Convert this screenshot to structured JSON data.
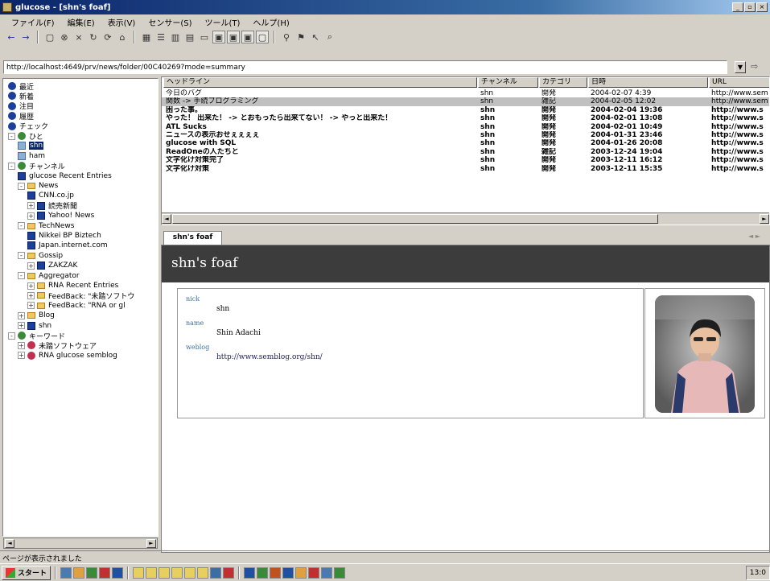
{
  "window": {
    "title": "glucose - [shn's foaf]",
    "minimize_glyph": "_",
    "restore_glyph": "▫",
    "close_glyph": "×"
  },
  "menubar": {
    "items": [
      "ファイル(F)",
      "編集(E)",
      "表示(V)",
      "センサー(S)",
      "ツール(T)",
      "ヘルプ(H)"
    ]
  },
  "toolbar": {
    "buttons": [
      {
        "icon": "back-arrow-icon",
        "glyph": "←"
      },
      {
        "icon": "forward-arrow-icon",
        "glyph": "→"
      },
      {
        "icon": "document-icon",
        "glyph": "▢"
      },
      {
        "icon": "stop-icon",
        "glyph": "⊗"
      },
      {
        "icon": "close-icon",
        "glyph": "×"
      },
      {
        "icon": "refresh-icon",
        "glyph": "↻"
      },
      {
        "icon": "refresh-all-icon",
        "glyph": "⟳"
      },
      {
        "icon": "home-icon",
        "glyph": "⌂"
      },
      {
        "icon": "grid-view-icon",
        "glyph": "▦"
      },
      {
        "icon": "list-view-icon",
        "glyph": "☰"
      },
      {
        "icon": "columns-view-icon",
        "glyph": "▥"
      },
      {
        "icon": "tile-view-icon",
        "glyph": "▤"
      },
      {
        "icon": "horizontal-split-icon",
        "glyph": "▭"
      },
      {
        "icon": "layout-1-icon",
        "glyph": "▣"
      },
      {
        "icon": "layout-2-icon",
        "glyph": "▣"
      },
      {
        "icon": "layout-3-icon",
        "glyph": "▣"
      },
      {
        "icon": "layout-4-icon",
        "glyph": "▢"
      },
      {
        "icon": "wand-icon",
        "glyph": "⚲"
      },
      {
        "icon": "filter-icon",
        "glyph": "⚑"
      },
      {
        "icon": "pointer-icon",
        "glyph": "↖"
      },
      {
        "icon": "search-icon",
        "glyph": "⌕"
      }
    ]
  },
  "address": {
    "url": "http://localhost:4649/prv/news/folder/00C40269?mode=summary",
    "dropdown_glyph": "▼",
    "go_glyph": "⇨"
  },
  "tree": {
    "nodes": [
      {
        "label": "最近",
        "icon": "recent-icon",
        "depth": 0,
        "expander": "",
        "type": "dot",
        "color": "#1c3f9a"
      },
      {
        "label": "新着",
        "icon": "new-items-icon",
        "depth": 0,
        "expander": "",
        "type": "dot",
        "color": "#1c3f9a"
      },
      {
        "label": "注目",
        "icon": "starred-icon",
        "depth": 0,
        "expander": "",
        "type": "dot",
        "color": "#1c3f9a"
      },
      {
        "label": "履歴",
        "icon": "history-icon",
        "depth": 0,
        "expander": "",
        "type": "dot",
        "color": "#1c3f9a"
      },
      {
        "label": "チェック",
        "icon": "check-icon",
        "depth": 0,
        "expander": "",
        "type": "dot",
        "color": "#1c3f9a"
      },
      {
        "label": "ひと",
        "icon": "people-icon",
        "depth": 0,
        "expander": "-",
        "type": "dot",
        "color": "#3a8a3a"
      },
      {
        "label": "shn",
        "icon": "person-icon",
        "depth": 1,
        "expander": "",
        "type": "person",
        "selected": true
      },
      {
        "label": "ham",
        "icon": "person-icon",
        "depth": 1,
        "expander": "",
        "type": "person"
      },
      {
        "label": "チャンネル",
        "icon": "channel-icon",
        "depth": 0,
        "expander": "-",
        "type": "dot",
        "color": "#3a8a3a"
      },
      {
        "label": "glucose Recent Entries",
        "icon": "feed-icon",
        "depth": 1,
        "expander": "",
        "type": "feed"
      },
      {
        "label": "News",
        "icon": "folder-icon",
        "depth": 1,
        "expander": "-",
        "type": "folder"
      },
      {
        "label": "CNN.co.jp",
        "icon": "feed-icon",
        "depth": 2,
        "expander": "",
        "type": "feed"
      },
      {
        "label": "読売新聞",
        "icon": "feed-icon",
        "depth": 2,
        "expander": "+",
        "type": "feed"
      },
      {
        "label": "Yahoo! News",
        "icon": "feed-icon",
        "depth": 2,
        "expander": "+",
        "type": "feed"
      },
      {
        "label": "TechNews",
        "icon": "folder-icon",
        "depth": 1,
        "expander": "-",
        "type": "folder"
      },
      {
        "label": "Nikkei BP Biztech",
        "icon": "feed-icon",
        "depth": 2,
        "expander": "",
        "type": "feed"
      },
      {
        "label": "Japan.internet.com",
        "icon": "feed-icon",
        "depth": 2,
        "expander": "",
        "type": "feed"
      },
      {
        "label": "Gossip",
        "icon": "folder-icon",
        "depth": 1,
        "expander": "-",
        "type": "folder"
      },
      {
        "label": "ZAKZAK",
        "icon": "feed-icon",
        "depth": 2,
        "expander": "+",
        "type": "feed"
      },
      {
        "label": "Aggregator",
        "icon": "folder-icon",
        "depth": 1,
        "expander": "-",
        "type": "folder"
      },
      {
        "label": "RNA Recent Entries",
        "icon": "folder-icon",
        "depth": 2,
        "expander": "+",
        "type": "folder"
      },
      {
        "label": "FeedBack: \"未踏ソフトウ",
        "icon": "folder-icon",
        "depth": 2,
        "expander": "+",
        "type": "folder"
      },
      {
        "label": "FeedBack: \"RNA or gl",
        "icon": "folder-icon",
        "depth": 2,
        "expander": "+",
        "type": "folder"
      },
      {
        "label": "Blog",
        "icon": "folder-icon",
        "depth": 1,
        "expander": "+",
        "type": "folder"
      },
      {
        "label": "shn",
        "icon": "feed-icon",
        "depth": 1,
        "expander": "+",
        "type": "feed"
      },
      {
        "label": "キーワード",
        "icon": "keyword-icon",
        "depth": 0,
        "expander": "-",
        "type": "dot",
        "color": "#3a8a3a"
      },
      {
        "label": "未踏ソフトウェア",
        "icon": "keyword-icon",
        "depth": 1,
        "expander": "+",
        "type": "dot",
        "color": "#c03050"
      },
      {
        "label": "RNA glucose semblog",
        "icon": "keyword-icon",
        "depth": 1,
        "expander": "+",
        "type": "dot",
        "color": "#c03050"
      }
    ],
    "scroll_left": "◄",
    "scroll_right": "►"
  },
  "grid": {
    "columns": [
      "ヘッドライン",
      "チャンネル",
      "カテゴリ",
      "日時",
      "URL"
    ],
    "rows": [
      {
        "headline": "今日のバグ",
        "channel": "shn",
        "category": "開発",
        "date": "2004-02-07 4:39",
        "url": "http://www.sem",
        "bold": false,
        "selected": false
      },
      {
        "headline": "関数 -> 手続プログラミング",
        "channel": "shn",
        "category": "雑記",
        "date": "2004-02-05 12:02",
        "url": "http://www.sem",
        "bold": false,
        "selected": true
      },
      {
        "headline": "困った事。",
        "channel": "shn",
        "category": "開発",
        "date": "2004-02-04 19:36",
        "url": "http://www.s",
        "bold": true,
        "selected": false
      },
      {
        "headline": "やった！ 出来た！ -> とおもったら出来てない！ -> やっと出来た！",
        "channel": "shn",
        "category": "開発",
        "date": "2004-02-01 13:08",
        "url": "http://www.s",
        "bold": true,
        "selected": false
      },
      {
        "headline": "ATL Sucks",
        "channel": "shn",
        "category": "開発",
        "date": "2004-02-01 10:49",
        "url": "http://www.s",
        "bold": true,
        "selected": false
      },
      {
        "headline": "ニュースの表示おせぇぇぇぇ",
        "channel": "shn",
        "category": "開発",
        "date": "2004-01-31 23:46",
        "url": "http://www.s",
        "bold": true,
        "selected": false
      },
      {
        "headline": "glucose with SQL",
        "channel": "shn",
        "category": "開発",
        "date": "2004-01-26 20:08",
        "url": "http://www.s",
        "bold": true,
        "selected": false
      },
      {
        "headline": "ReadOneの人たちと",
        "channel": "shn",
        "category": "雑記",
        "date": "2003-12-24 19:04",
        "url": "http://www.s",
        "bold": true,
        "selected": false
      },
      {
        "headline": "文字化け対策完了",
        "channel": "shn",
        "category": "開発",
        "date": "2003-12-11 16:12",
        "url": "http://www.s",
        "bold": true,
        "selected": false
      },
      {
        "headline": "文字化け対策",
        "channel": "shn",
        "category": "開発",
        "date": "2003-12-11 15:35",
        "url": "http://www.s",
        "bold": true,
        "selected": false
      }
    ],
    "scroll_left": "◄",
    "scroll_right": "►"
  },
  "detail": {
    "tab_label": "shn's foaf",
    "tab_nav": "◄ ►",
    "title": "shn's foaf",
    "fields": [
      {
        "label": "nick",
        "value": "shn"
      },
      {
        "label": "name",
        "value": "Shin Adachi"
      },
      {
        "label": "weblog",
        "value": "http://www.semblog.org/shn/"
      }
    ]
  },
  "statusbar": {
    "text": "ページが表示されました"
  },
  "taskbar": {
    "start_label": "スタート",
    "clock": "13:0"
  },
  "colors": {
    "titlebar_start": "#0a246a",
    "selection": "#0a246a",
    "detail_header": "#3c3c3c",
    "field_label": "#3a6ea5"
  }
}
